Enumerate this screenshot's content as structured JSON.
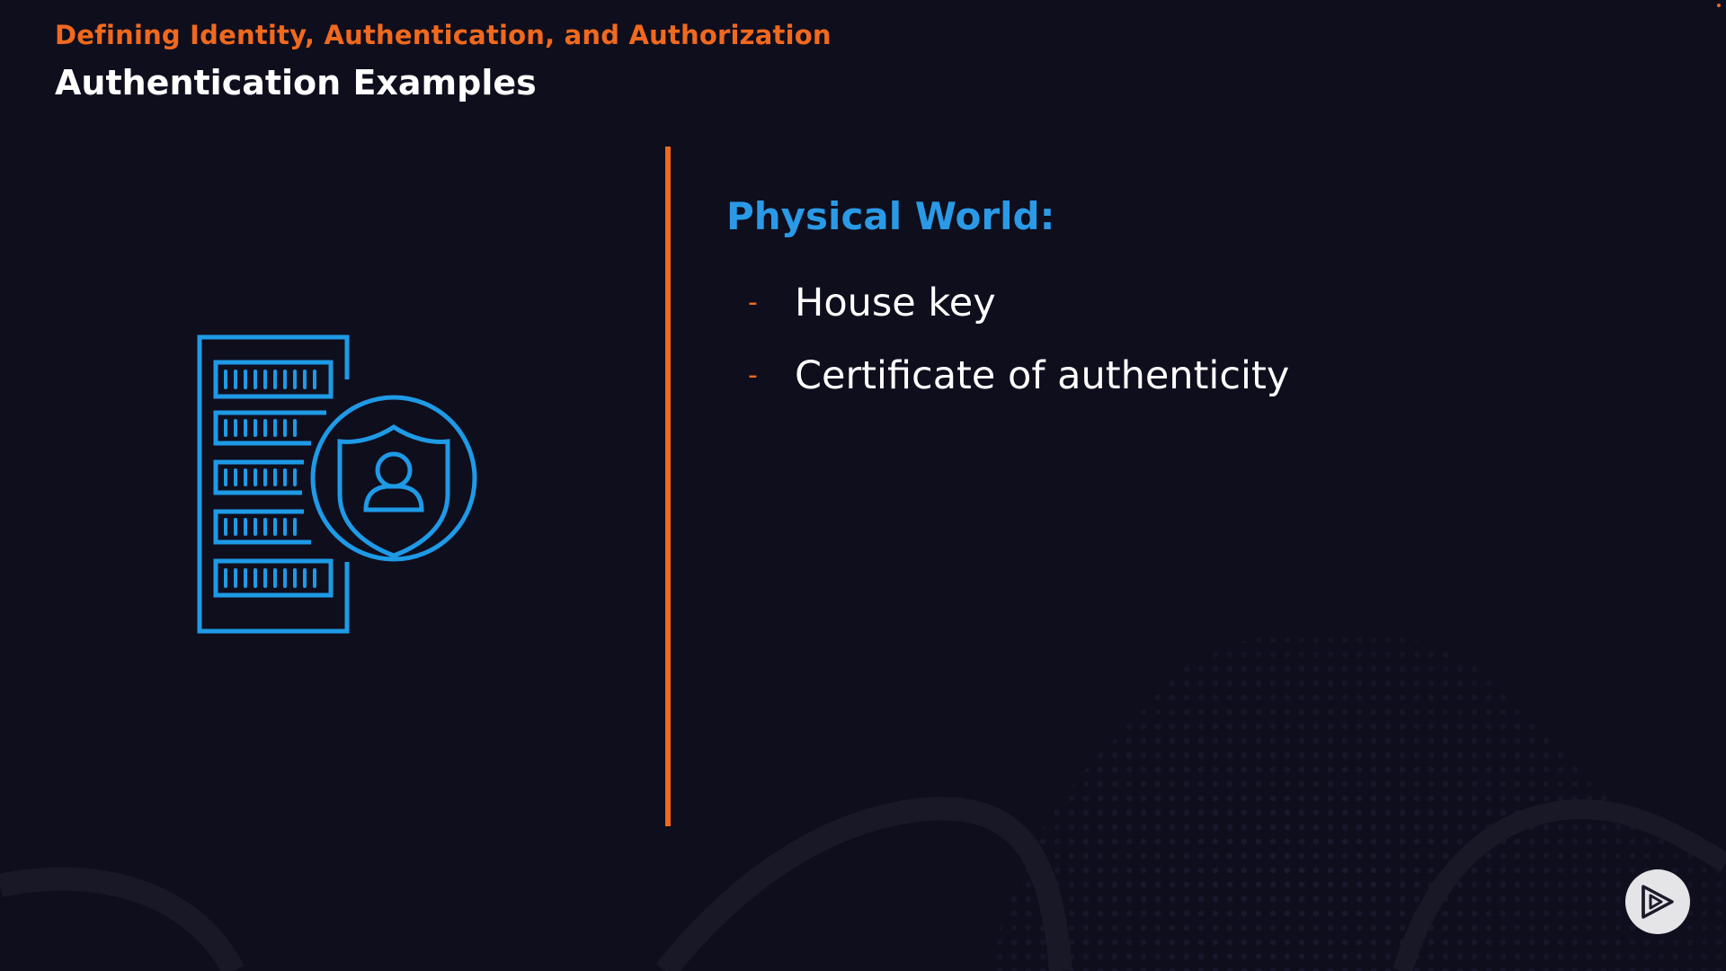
{
  "slide": {
    "subtitle": "Defining Identity, Authentication, and Authorization",
    "title": "Authentication Examples",
    "section_heading": "Physical World:",
    "bullets": [
      {
        "dash": "-",
        "text": "House key"
      },
      {
        "dash": "-",
        "text": "Certificate of authenticity"
      }
    ]
  },
  "icons": {
    "illustration": "server-shield-user-icon",
    "logo": "play-logo-icon"
  },
  "colors": {
    "background": "#0f0e1d",
    "accent_orange": "#f0691e",
    "accent_blue": "#2a9ae6",
    "text_white": "#ffffff"
  }
}
